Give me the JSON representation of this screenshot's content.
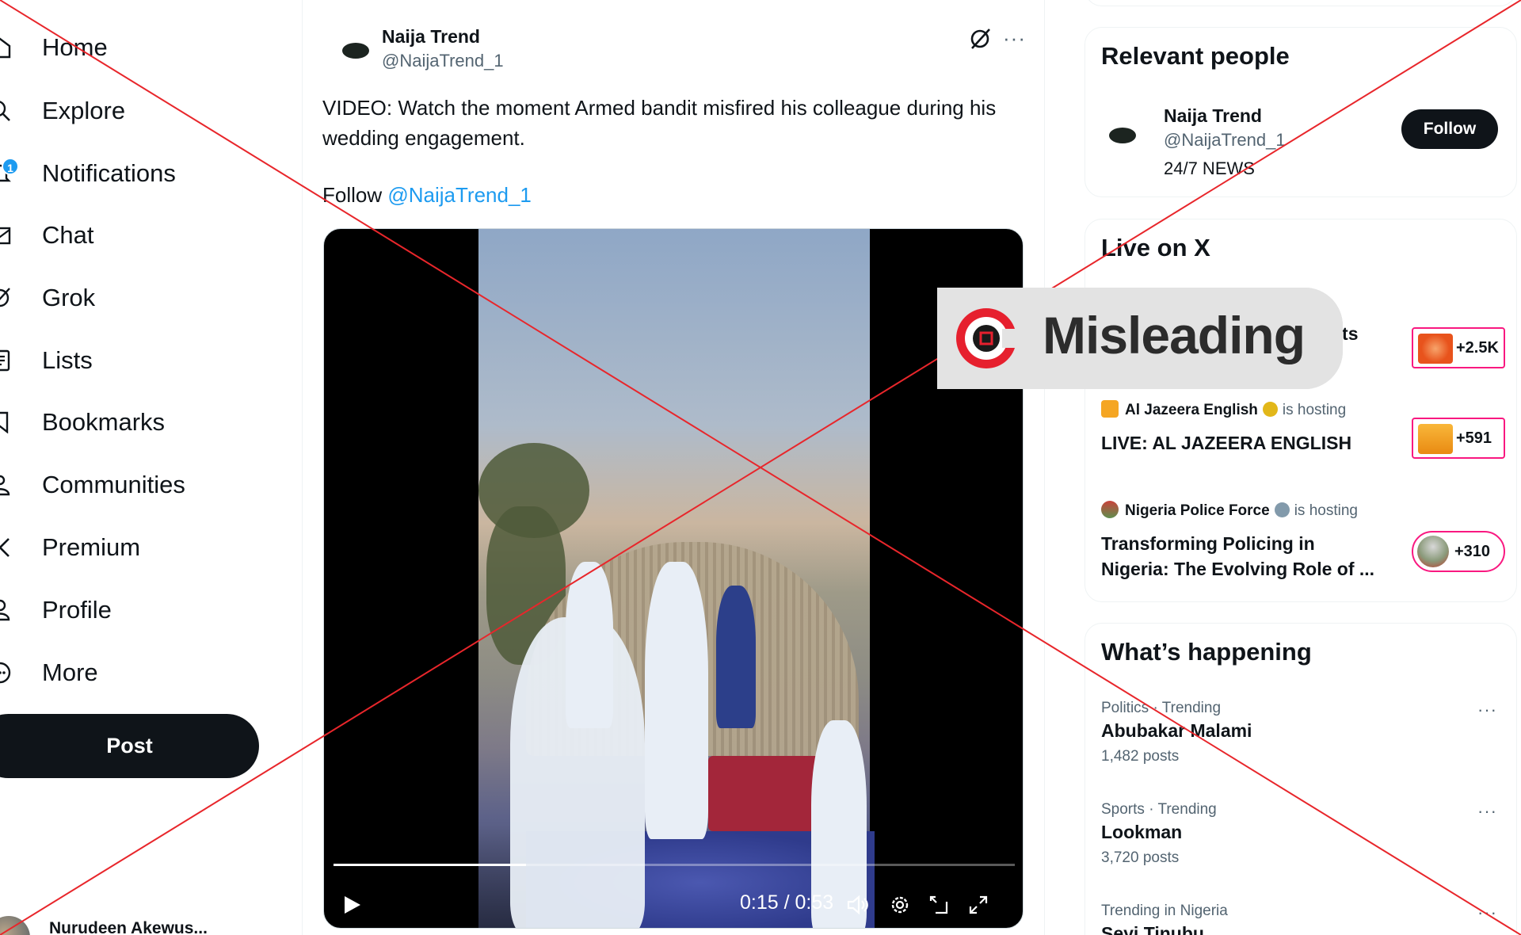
{
  "nav": {
    "items": [
      {
        "label": "Home",
        "icon": "home-icon"
      },
      {
        "label": "Explore",
        "icon": "search-icon"
      },
      {
        "label": "Notifications",
        "icon": "bell-icon",
        "badge": "1"
      },
      {
        "label": "Chat",
        "icon": "mail-icon"
      },
      {
        "label": "Grok",
        "icon": "grok-icon"
      },
      {
        "label": "Lists",
        "icon": "list-icon"
      },
      {
        "label": "Bookmarks",
        "icon": "bookmark-icon"
      },
      {
        "label": "Communities",
        "icon": "communities-icon"
      },
      {
        "label": "Premium",
        "icon": "x-logo-icon"
      },
      {
        "label": "Profile",
        "icon": "person-icon"
      },
      {
        "label": "More",
        "icon": "more-circle-icon"
      }
    ],
    "post_label": "Post",
    "account_name": "Nurudeen Akewus..."
  },
  "tweet": {
    "author_name": "Naija Trend",
    "author_handle": "@NaijaTrend_1",
    "text": "VIDEO: Watch the moment Armed bandit misfired his colleague during his wedding engagement.",
    "follow_prefix": "Follow ",
    "follow_mention": "@NaijaTrend_1",
    "video": {
      "time_label": "0:15 / 0:53",
      "progress_fraction": 0.283
    }
  },
  "relevant_people": {
    "title": "Relevant people",
    "person": {
      "name": "Naija Trend",
      "handle": "@NaijaTrend_1",
      "bio": "24/7 NEWS",
      "follow_label": "Follow"
    }
  },
  "live": {
    "title": "Live on X",
    "items": [
      {
        "host": "",
        "title_fragment": "nts",
        "count": "+2.5K",
        "pill_color": "#e8531c"
      },
      {
        "host": "Al Jazeera English",
        "hosting": "is hosting",
        "title": "LIVE: AL JAZEERA ENGLISH",
        "count": "+591",
        "pill_color": "#f5a623",
        "verified_color": "#e2b719"
      },
      {
        "host": "Nigeria Police Force",
        "hosting": "is hosting",
        "title_line1": "Transforming Policing in",
        "title_line2": "Nigeria: The Evolving Role of ...",
        "count": "+310",
        "verified_color": "#829aab"
      }
    ]
  },
  "happening": {
    "title": "What’s happening",
    "trends": [
      {
        "category": "Politics · Trending",
        "title": "Abubakar Malami",
        "count": "1,482 posts"
      },
      {
        "category": "Sports · Trending",
        "title": "Lookman",
        "count": "3,720 posts"
      },
      {
        "category": "Trending in Nigeria",
        "title": "Seyi Tinubu",
        "count": ""
      }
    ]
  },
  "overlay": {
    "label": "Misleading",
    "accent": "#e6202e",
    "line_color": "#e8262b"
  }
}
